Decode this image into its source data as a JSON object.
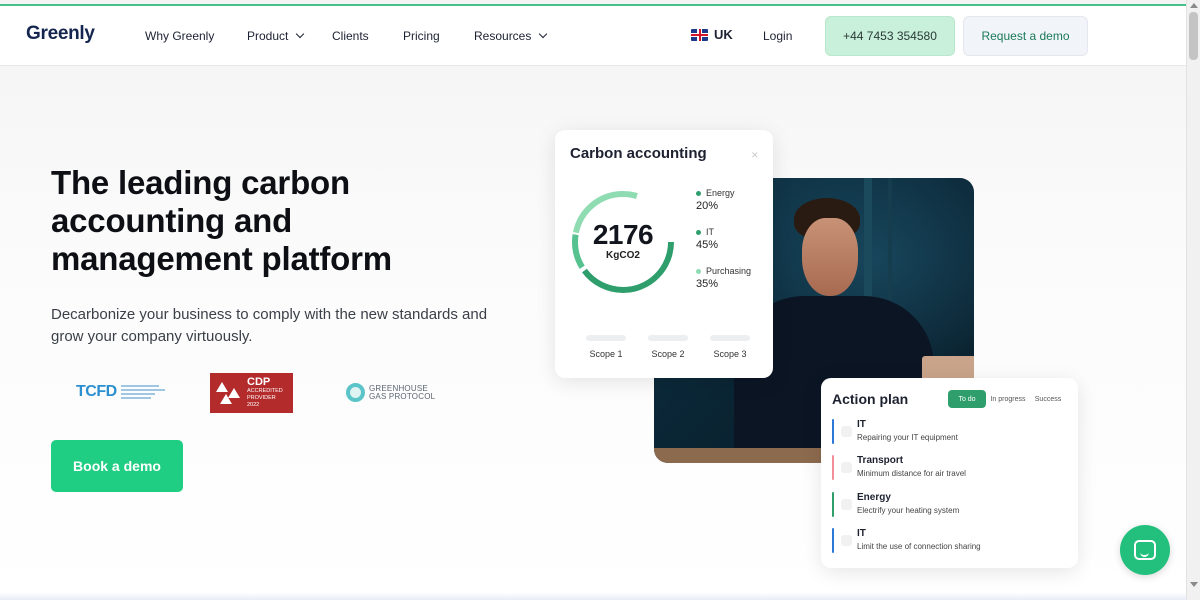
{
  "header": {
    "logo": "Greenly",
    "nav": [
      {
        "label": "Why Greenly"
      },
      {
        "label": "Product"
      },
      {
        "label": "Clients"
      },
      {
        "label": "Pricing"
      },
      {
        "label": "Resources"
      }
    ],
    "region": "UK",
    "login": "Login",
    "phone": "+44 7453 354580",
    "request_demo": "Request a demo"
  },
  "hero": {
    "title": "The leading carbon accounting and management platform",
    "subtitle": "Decarbonize your business to comply with the new standards and grow your company virtuously.",
    "book_demo": "Book a demo",
    "logos": {
      "tcfd": "TCFD",
      "cdp_big": "CDP",
      "cdp_small_1": "ACCREDITED",
      "cdp_small_2": "PROVIDER",
      "cdp_small_3": "2022",
      "ghg_line1": "GREENHOUSE",
      "ghg_line2": "GAS PROTOCOL"
    }
  },
  "carbon_card": {
    "title": "Carbon accounting",
    "total": "2176",
    "unit": "KgCO2",
    "breakdown": [
      {
        "label": "Energy",
        "percent": "20%",
        "color": "#2f9e6d"
      },
      {
        "label": "IT",
        "percent": "45%",
        "color": "#2f9e6d"
      },
      {
        "label": "Purchasing",
        "percent": "35%",
        "color": "#8fdcb3"
      }
    ],
    "scopes": [
      "Scope 1",
      "Scope 2",
      "Scope 3"
    ]
  },
  "action_plan": {
    "title": "Action plan",
    "tabs": [
      "To do",
      "In progress",
      "Success"
    ],
    "items": [
      {
        "title": "IT",
        "desc": "Repairing your IT equipment",
        "color": "#2b78d6"
      },
      {
        "title": "Transport",
        "desc": "Minimum distance for air travel",
        "color": "#f08f9a"
      },
      {
        "title": "Energy",
        "desc": "Electrify your heating system",
        "color": "#2f9e6d"
      },
      {
        "title": "IT",
        "desc": "Limit the use of connection sharing",
        "color": "#2b78d6"
      }
    ]
  },
  "colors": {
    "accent": "#1fce82",
    "brand_navy": "#14264f",
    "ring_dark": "#2f9e6d",
    "ring_light": "#8fdcb3"
  },
  "icons": [
    "chevron-down-icon",
    "uk-flag-icon",
    "chat-icon"
  ]
}
